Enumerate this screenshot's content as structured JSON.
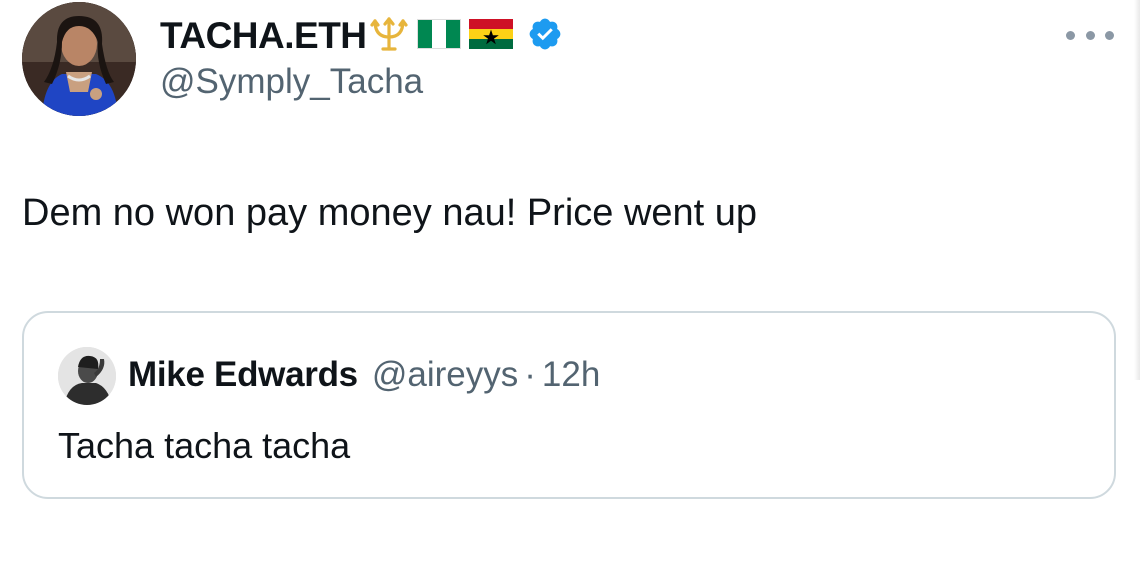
{
  "tweet": {
    "author": {
      "display_name": "TACHA.ETH",
      "handle": "@Symply_Tacha",
      "badges": [
        "trident-icon",
        "nigeria-flag-icon",
        "ghana-flag-icon",
        "verified-icon"
      ]
    },
    "text": "Dem no won pay money nau! Price went up",
    "more_icon": "more-options-icon",
    "quoted_tweet": {
      "author_name": "Mike Edwards",
      "handle": "@aireyys",
      "separator": "·",
      "time": "12h",
      "text": "Tacha tacha tacha"
    }
  },
  "colors": {
    "text_primary": "#0f1419",
    "text_secondary": "#536471",
    "verified_blue": "#1d9bf0",
    "trident_gold": "#e7b53c",
    "card_border": "#cfd9de"
  }
}
